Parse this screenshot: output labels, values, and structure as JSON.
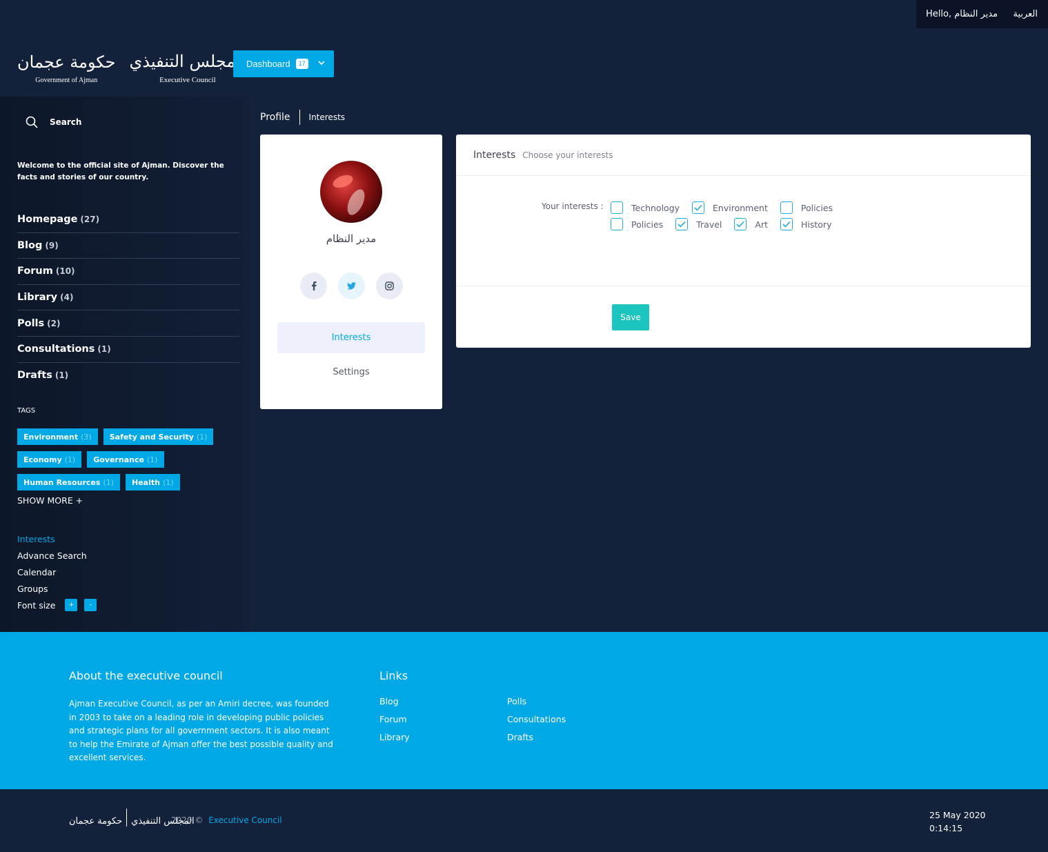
{
  "topbar": {
    "greeting": "Hello, مدير النظام",
    "language": "العربية"
  },
  "logo": {
    "gov_ar": "حكومة عجمان",
    "gov_en": "Government of Ajman",
    "council_ar": "المجلس التنفيذي",
    "council_en": "Executive Council"
  },
  "dashboard": {
    "label": "Dashboard",
    "badge": "17"
  },
  "sidebar": {
    "search_label": "Search",
    "welcome": "Welcome to the official site of Ajman. Discover the facts and stories of our country.",
    "nav": [
      {
        "label": "Homepage",
        "count": "(27)"
      },
      {
        "label": "Blog",
        "count": "(9)"
      },
      {
        "label": "Forum",
        "count": "(10)"
      },
      {
        "label": "Library",
        "count": "(4)"
      },
      {
        "label": "Polls",
        "count": "(2)"
      },
      {
        "label": "Consultations",
        "count": "(1)"
      },
      {
        "label": "Drafts",
        "count": "(1)"
      }
    ],
    "tags_title": "TAGS",
    "tags": [
      {
        "label": "Environment",
        "count": "(3)"
      },
      {
        "label": "Safety and Security",
        "count": "(1)"
      },
      {
        "label": "Economy",
        "count": "(1)"
      },
      {
        "label": "Governance",
        "count": "(1)"
      },
      {
        "label": "Human Resources",
        "count": "(1)"
      },
      {
        "label": "Health",
        "count": "(1)"
      }
    ],
    "show_more": "SHOW MORE +",
    "links": [
      "Interests",
      "Advance Search",
      "Calendar",
      "Groups"
    ],
    "font_size_label": "Font size",
    "font_plus": "+",
    "font_minus": "-"
  },
  "breadcrumb": {
    "profile": "Profile",
    "current": "Interests"
  },
  "profile": {
    "name": "مدير النظام",
    "menu_interests": "Interests",
    "menu_settings": "Settings",
    "social_icons": [
      "facebook-icon",
      "twitter-icon",
      "instagram-icon"
    ]
  },
  "interests": {
    "title": "Interests",
    "subtitle": "Choose your interests",
    "label": "Your interests :",
    "row1": [
      {
        "label": "Technology",
        "checked": false
      },
      {
        "label": "Environment",
        "checked": true
      },
      {
        "label": "Policies",
        "checked": false
      }
    ],
    "row2": [
      {
        "label": "Policies",
        "checked": false
      },
      {
        "label": "Travel",
        "checked": true
      },
      {
        "label": "Art",
        "checked": true
      },
      {
        "label": "History",
        "checked": true
      }
    ],
    "save": "Save"
  },
  "footer": {
    "about_title": "About the executive council",
    "about_text": "Ajman Executive Council, as per an Amiri decree, was founded in 2003 to take on a leading role in developing public policies and strategic plans for all government sectors. It is also meant to help the Emirate of Ajman offer the best possible quality and excellent services.",
    "links_title": "Links",
    "links_col1": [
      "Blog",
      "Forum",
      "Library"
    ],
    "links_col2": [
      "Polls",
      "Consultations",
      "Drafts"
    ]
  },
  "bottom": {
    "copyright": "2020 ©",
    "org_link": "Executive Council",
    "date": "25 May 2020",
    "time": "0:14:15"
  },
  "colors": {
    "accent": "#00a9e6",
    "save": "#1bc5bd",
    "background": "#14213a"
  }
}
